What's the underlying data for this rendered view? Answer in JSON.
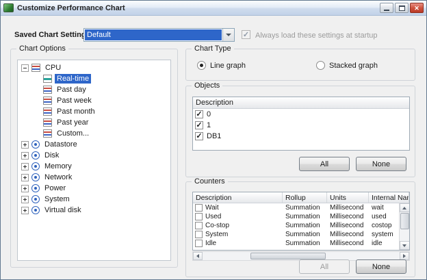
{
  "window": {
    "title": "Customize Performance Chart"
  },
  "settings": {
    "label": "Saved Chart Settings:",
    "dropdown_value": "Default",
    "startup_checkbox_label": "Always load these settings at startup",
    "startup_checked": true
  },
  "chart_options": {
    "title": "Chart Options",
    "cpu": {
      "label": "CPU",
      "expanded": true,
      "children": [
        "Real-time",
        "Past day",
        "Past week",
        "Past month",
        "Past year",
        "Custom..."
      ]
    },
    "real_time_selected": true,
    "roots": [
      "Datastore",
      "Disk",
      "Memory",
      "Network",
      "Power",
      "System",
      "Virtual disk"
    ]
  },
  "chart_type": {
    "title": "Chart Type",
    "line_graph_label": "Line graph",
    "stacked_graph_label": "Stacked graph",
    "line_graph_selected": true,
    "stacked_graph_selected": false
  },
  "objects": {
    "title": "Objects",
    "column_header": "Description",
    "items": [
      {
        "label": "0",
        "checked": true
      },
      {
        "label": "1",
        "checked": true
      },
      {
        "label": "DB1",
        "checked": true
      }
    ],
    "all_button": "All",
    "none_button": "None"
  },
  "counters": {
    "title": "Counters",
    "columns": [
      "Description",
      "Rollup",
      "Units",
      "Internal Name"
    ],
    "rows": [
      {
        "description": "Wait",
        "rollup": "Summation",
        "units": "Millisecond",
        "internal_name": "wait",
        "checked": false
      },
      {
        "description": "Used",
        "rollup": "Summation",
        "units": "Millisecond",
        "internal_name": "used",
        "checked": false
      },
      {
        "description": "Co-stop",
        "rollup": "Summation",
        "units": "Millisecond",
        "internal_name": "costop",
        "checked": false
      },
      {
        "description": "System",
        "rollup": "Summation",
        "units": "Millisecond",
        "internal_name": "system",
        "checked": false
      },
      {
        "description": "Idle",
        "rollup": "Summation",
        "units": "Millisecond",
        "internal_name": "idle",
        "checked": false
      }
    ],
    "all_button": "All",
    "all_disabled": true,
    "none_button": "None"
  },
  "colors": {
    "selection_blue": "#2e66c9",
    "close_button_red": "#b93a26",
    "dialog_background": "#f0f0f0"
  }
}
